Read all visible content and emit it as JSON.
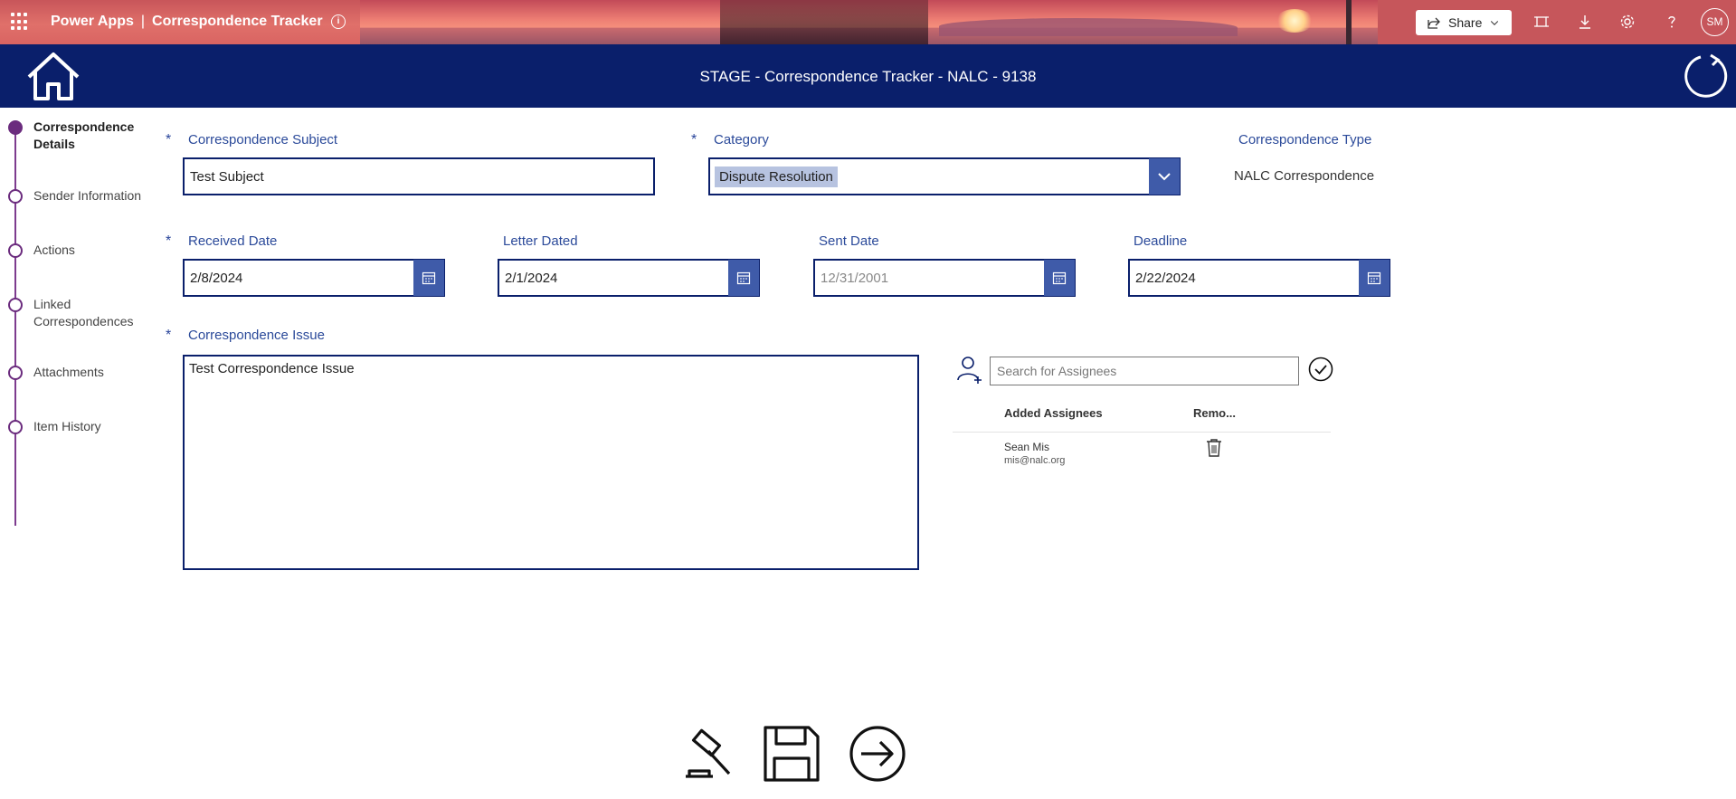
{
  "suitebar": {
    "app_name": "Power Apps",
    "separator": "|",
    "app_title": "Correspondence Tracker",
    "share_label": "Share",
    "user_initials": "SM",
    "icons": [
      "waffle-icon",
      "info-icon",
      "share-icon",
      "chevron-down-icon",
      "fit-to-screen-icon",
      "download-icon",
      "settings-icon",
      "help-icon"
    ]
  },
  "header": {
    "title": "STAGE - Correspondence Tracker  - NALC - 9138",
    "home_icon": "home-icon",
    "refresh_icon": "refresh-icon"
  },
  "steps": [
    {
      "label": "Correspondence Details",
      "active": true
    },
    {
      "label": "Sender Information",
      "active": false
    },
    {
      "label": "Actions",
      "active": false
    },
    {
      "label": "Linked Correspondences",
      "active": false
    },
    {
      "label": "Attachments",
      "active": false
    },
    {
      "label": "Item History",
      "active": false
    }
  ],
  "form": {
    "required_marker": "*",
    "subject": {
      "label": "Correspondence Subject",
      "value": "Test Subject"
    },
    "category": {
      "label": "Category",
      "value": "Dispute Resolution"
    },
    "type": {
      "label": "Correspondence Type",
      "value": "NALC Correspondence"
    },
    "received_date": {
      "label": "Received Date",
      "value": "2/8/2024"
    },
    "letter_dated": {
      "label": "Letter Dated",
      "value": "2/1/2024"
    },
    "sent_date": {
      "label": "Sent Date",
      "value": "12/31/2001"
    },
    "deadline": {
      "label": "Deadline",
      "value": "2/22/2024"
    },
    "issue": {
      "label": "Correspondence Issue",
      "value": "Test Correspondence Issue"
    }
  },
  "assignees": {
    "search_placeholder": "Search for Assignees",
    "col_added": "Added Assignees",
    "col_remove": "Remo...",
    "rows": [
      {
        "name": "Sean Mis",
        "email": "mis@nalc.org"
      }
    ]
  },
  "colors": {
    "header_bg": "#0a1f6b",
    "accent_blue": "#3f5ba9",
    "step_purple": "#6b2c7e",
    "label_blue": "#2b4a9a"
  }
}
